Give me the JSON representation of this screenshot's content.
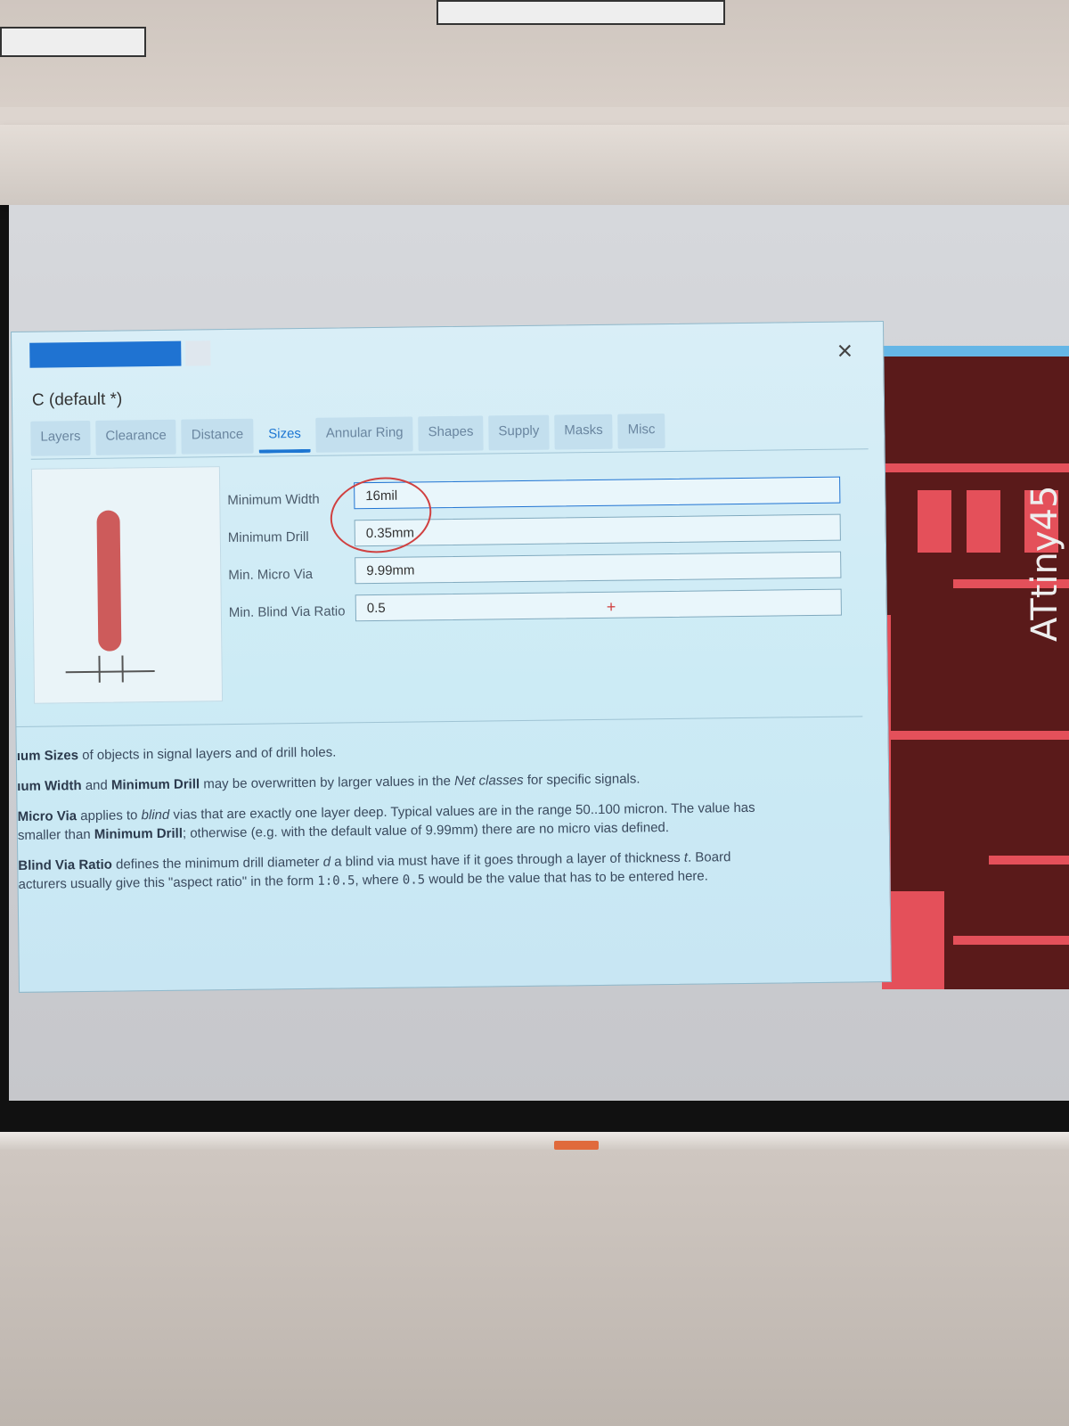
{
  "dialog": {
    "title": "C (default *)",
    "close_glyph": "×"
  },
  "tabs": [
    {
      "label": "Layers"
    },
    {
      "label": "Clearance"
    },
    {
      "label": "Distance"
    },
    {
      "label": "Sizes",
      "active": true
    },
    {
      "label": "Annular Ring"
    },
    {
      "label": "Shapes"
    },
    {
      "label": "Supply"
    },
    {
      "label": "Masks"
    },
    {
      "label": "Misc"
    }
  ],
  "fields": {
    "min_width": {
      "label": "Minimum Width",
      "value": "16mil"
    },
    "min_drill": {
      "label": "Minimum Drill",
      "value": "0.35mm"
    },
    "min_micro_via": {
      "label": "Min. Micro Via",
      "value": "9.99mm"
    },
    "min_blind_via_ratio": {
      "label": "Min. Blind Via Ratio",
      "value": "0.5"
    }
  },
  "help": {
    "p1_bold": "ıum Sizes",
    "p1_rest": " of objects in signal layers and of drill holes.",
    "p2_bold1": "ıum Width",
    "p2_and": " and ",
    "p2_bold2": "Minimum Drill",
    "p2_mid": " may be overwritten by larger values in the ",
    "p2_italic": "Net classes",
    "p2_end": " for specific signals.",
    "p3_bold": "Micro Via",
    "p3_a": " applies to ",
    "p3_italic": "blind",
    "p3_b": " vias that are exactly one layer deep. Typical values are in the range 50..100 micron. The value has",
    "p3_line2a": "smaller than ",
    "p3_bold2": "Minimum Drill",
    "p3_line2b": "; otherwise (e.g. with the default value of 9.99mm) there are no micro vias defined.",
    "p4_bold": "Blind Via Ratio",
    "p4_a": " defines the minimum drill diameter ",
    "p4_d": "d",
    "p4_b": " a blind via must have if it goes through a layer of thickness ",
    "p4_t": "t",
    "p4_c": ". Board",
    "p4_line2a": "acturers usually give this \"aspect ratio\" in the form ",
    "p4_mono1": "1:0.5",
    "p4_line2b": ", where ",
    "p4_mono2": "0.5",
    "p4_line2c": " would be the value that has to be entered here."
  },
  "pcb": {
    "label": "ATtiny45"
  },
  "colors": {
    "accent": "#1d76d2",
    "trace": "#e4505a",
    "annotation": "#d04040"
  }
}
